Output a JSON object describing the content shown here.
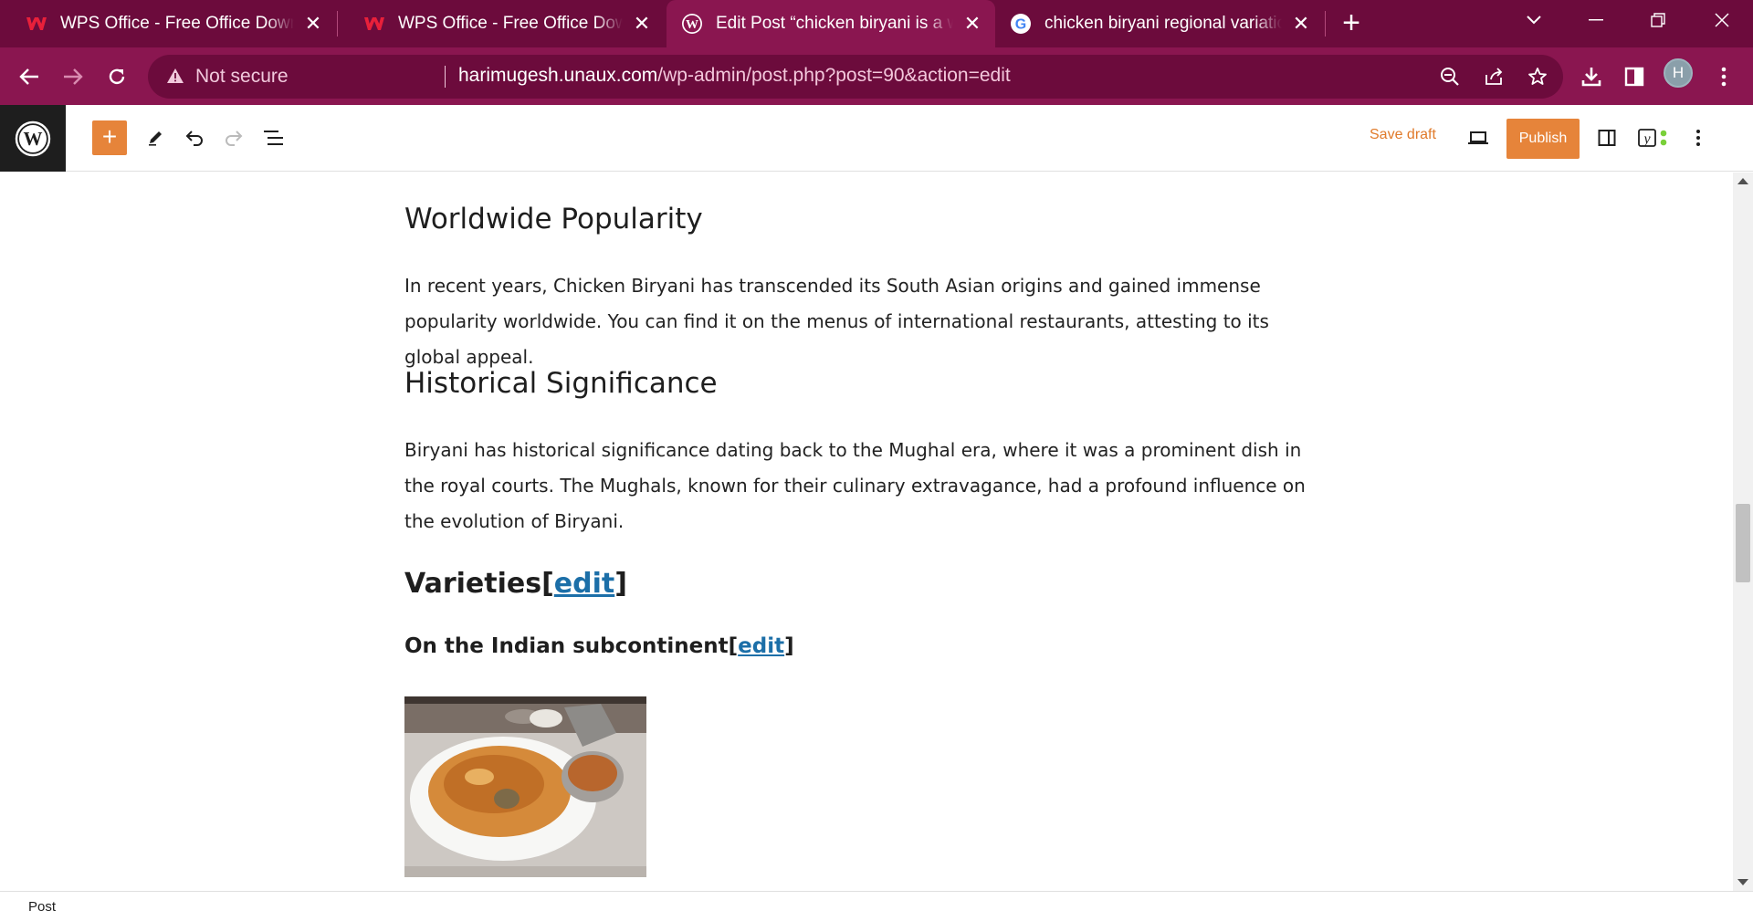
{
  "browser": {
    "tabs": [
      {
        "title": "WPS Office - Free Office Download for PC & Mobile",
        "icon": "wps-icon",
        "active": false
      },
      {
        "title": "WPS Office - Free Office Download for PC & Mobile",
        "icon": "wps-icon",
        "active": false
      },
      {
        "title": "Edit Post “chicken biryani is a world famous dish”",
        "icon": "wordpress-icon",
        "active": true
      },
      {
        "title": "chicken biryani regional variations",
        "icon": "google-icon",
        "active": false
      }
    ],
    "new_tab_symbol": "+",
    "close_symbol": "✕",
    "security_label": "Not secure",
    "url_host": "harimugesh.unaux.com",
    "url_path": "/wp-admin/post.php?post=90&action=edit",
    "profile_initial": "H",
    "accent_color": "#8a1650"
  },
  "editor": {
    "save_draft_label": "Save draft",
    "publish_label": "Publish",
    "inserter_symbol": "+",
    "accent_color": "#e6843a"
  },
  "content": {
    "section1": {
      "heading": "Worldwide Popularity",
      "paragraph": "In recent years, Chicken Biryani has transcended its South Asian origins and gained immense popularity worldwide. You can find it on the menus of international restaurants, attesting to its global appeal."
    },
    "section2": {
      "heading": "Historical Significance",
      "paragraph": "Biryani has historical significance dating back to the Mughal era, where it was a prominent dish in the royal courts. The Mughals, known for their culinary extravagance, had a profound influence on the evolution of Biryani."
    },
    "section3": {
      "heading": "Varieties",
      "edit_link": "edit",
      "open_bracket": "[",
      "close_bracket": "]"
    },
    "section4": {
      "heading": "On the Indian subcontinent",
      "edit_link": "edit",
      "open_bracket": "[",
      "close_bracket": "]"
    }
  },
  "footer": {
    "breadcrumb": "Post"
  }
}
